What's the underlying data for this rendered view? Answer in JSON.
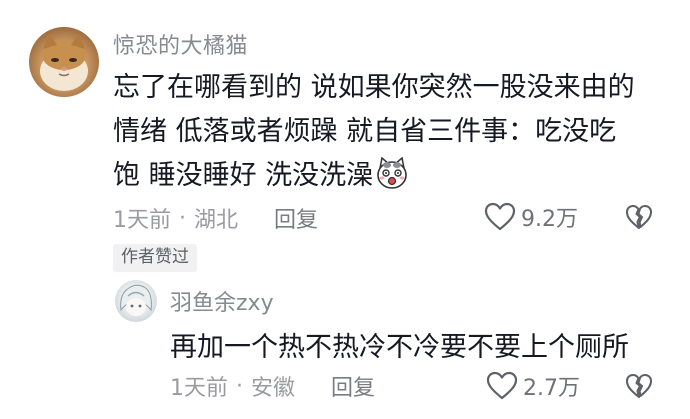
{
  "comment": {
    "username": "惊恐的大橘猫",
    "text_lines": [
      "忘了在哪看到的 说如果你突然一股没来由的",
      "情绪 低落或者烦躁 就自省三件事：吃没吃",
      "饱 睡没睡好 洗没洗澡"
    ],
    "emoji_icon": "surprised-cat-emoji-icon",
    "time": "1天前",
    "separator": "·",
    "location": "湖北",
    "reply_label": "回复",
    "like_count": "9.2万",
    "author_badge": "作者赞过"
  },
  "reply": {
    "username": "羽鱼余zxy",
    "text": "再加一个热不热冷不冷要不要上个厕所",
    "time": "1天前",
    "separator": "·",
    "location": "安徽",
    "reply_label": "回复",
    "like_count": "2.7万"
  },
  "icons": {
    "like": "heart-outline-icon",
    "dislike": "broken-heart-icon"
  },
  "colors": {
    "text": "#161823",
    "muted": "#9a9ba1",
    "username": "#888a91"
  }
}
